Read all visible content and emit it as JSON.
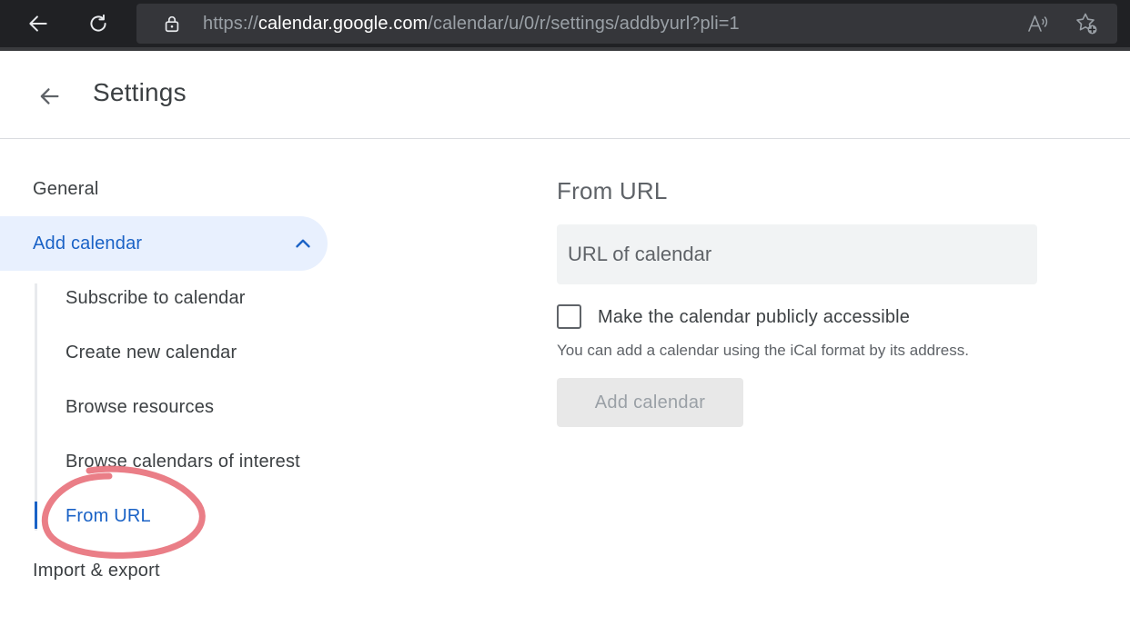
{
  "browser": {
    "url_scheme": "https://",
    "url_host": "calendar.google.com",
    "url_path": "/calendar/u/0/r/settings/addbyurl?pli=1",
    "icons": [
      "back-icon",
      "reload-icon",
      "lock-icon",
      "read-aloud-icon",
      "favorites-add-icon"
    ]
  },
  "header": {
    "title": "Settings",
    "back_icon": "arrow-left-icon"
  },
  "sidebar": {
    "general": "General",
    "add_calendar": "Add calendar",
    "add_calendar_expanded": true,
    "sub_items": [
      "Subscribe to calendar",
      "Create new calendar",
      "Browse resources",
      "Browse calendars of interest",
      "From URL"
    ],
    "active_sub_item": "From URL",
    "import_export": "Import & export"
  },
  "main": {
    "section_title": "From URL",
    "url_input": {
      "placeholder": "URL of calendar",
      "value": ""
    },
    "public_checkbox": {
      "label": "Make the calendar publicly accessible",
      "checked": false
    },
    "helper_text": "You can add a calendar using the iCal format by its address.",
    "add_button": "Add calendar",
    "add_button_enabled": false
  },
  "colors": {
    "accent": "#1a62c6",
    "active_bg": "#e8f0fe",
    "annotation": "#e8707a"
  }
}
